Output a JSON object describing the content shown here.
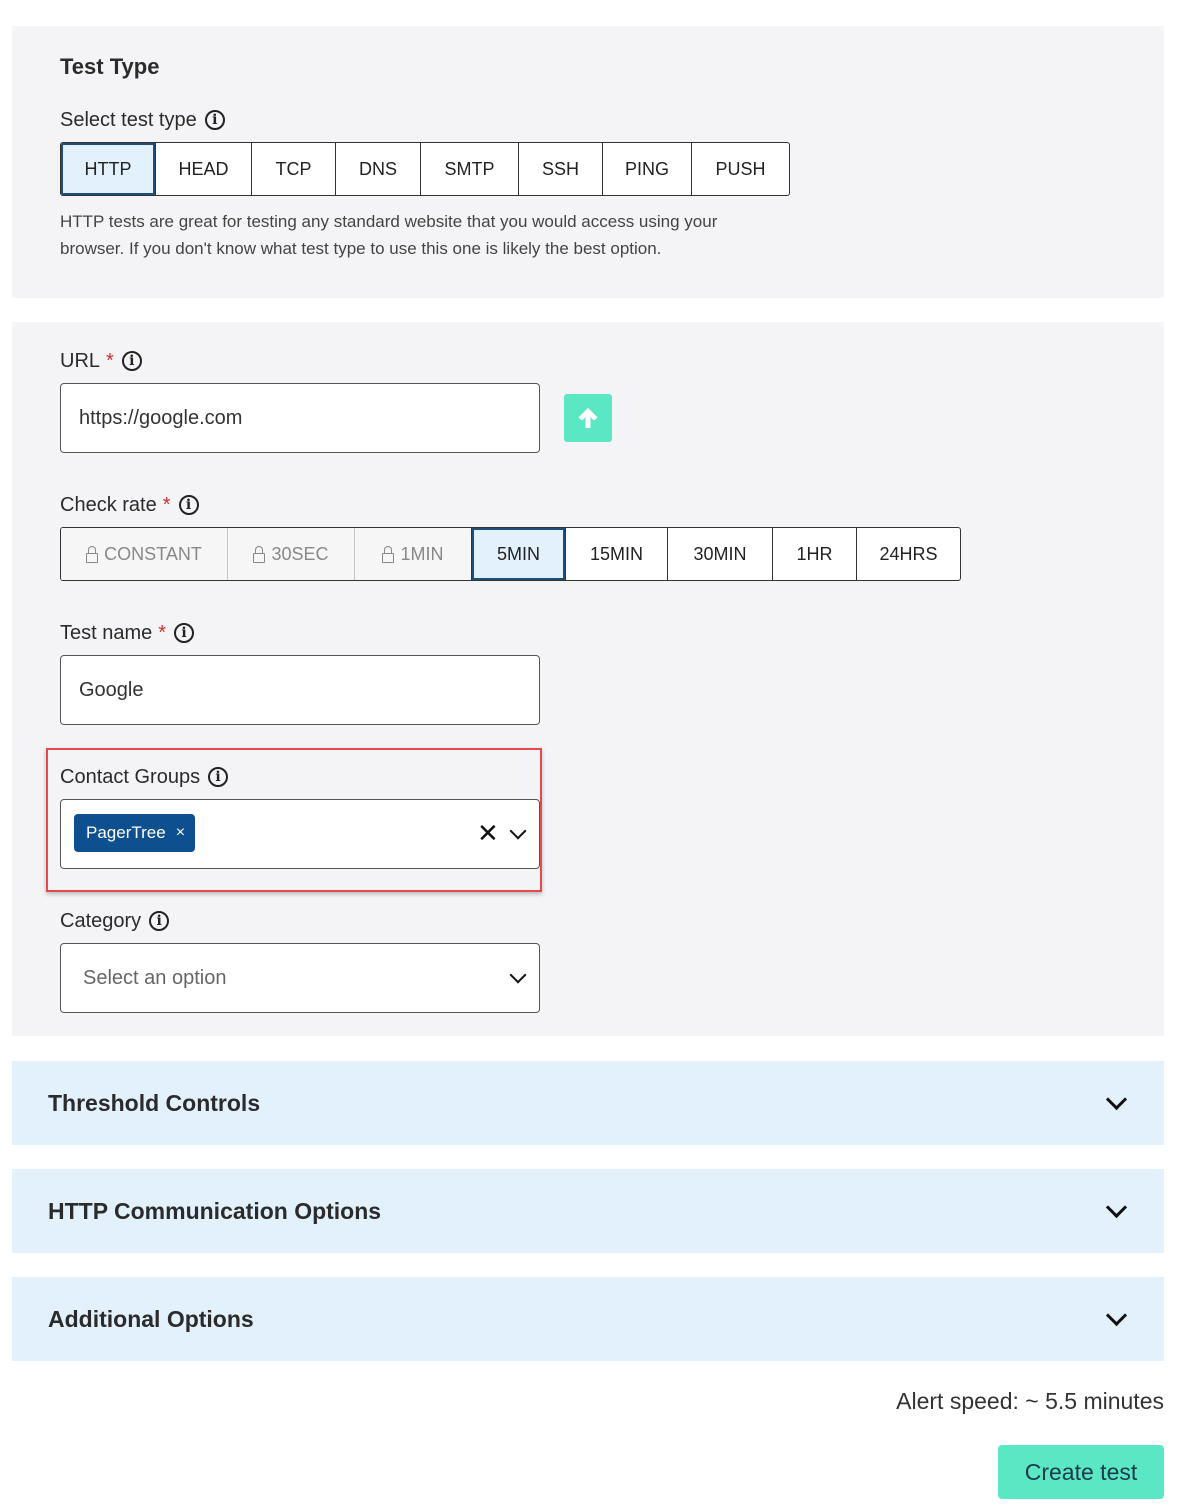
{
  "test_type_section": {
    "title": "Test Type",
    "select_label": "Select test type",
    "options": [
      "HTTP",
      "HEAD",
      "TCP",
      "DNS",
      "SMTP",
      "SSH",
      "PING",
      "PUSH"
    ],
    "selected": "HTTP",
    "description_line1": "HTTP tests are great for testing any standard website that you would access using your",
    "description_line2": "browser. If you don't know what test type to use this one is likely the best option."
  },
  "url": {
    "label": "URL",
    "required_mark": "*",
    "value": "https://google.com",
    "upload_icon": "arrow-up-icon"
  },
  "check_rate": {
    "label": "Check rate",
    "required_mark": "*",
    "options": [
      {
        "label": "CONSTANT",
        "locked": true
      },
      {
        "label": "30SEC",
        "locked": true
      },
      {
        "label": "1MIN",
        "locked": true
      },
      {
        "label": "5MIN",
        "locked": false
      },
      {
        "label": "15MIN",
        "locked": false
      },
      {
        "label": "30MIN",
        "locked": false
      },
      {
        "label": "1HR",
        "locked": false
      },
      {
        "label": "24HRS",
        "locked": false
      }
    ],
    "selected": "5MIN"
  },
  "test_name": {
    "label": "Test name",
    "required_mark": "*",
    "value": "Google"
  },
  "contact_groups": {
    "label": "Contact Groups",
    "chips": [
      "PagerTree"
    ],
    "chip_remove_glyph": "×",
    "clear_glyph": "✕"
  },
  "category": {
    "label": "Category",
    "placeholder": "Select an option"
  },
  "accordions": [
    {
      "title": "Threshold Controls"
    },
    {
      "title": "HTTP Communication Options"
    },
    {
      "title": "Additional Options"
    }
  ],
  "footer": {
    "alert_speed": "Alert speed: ~ 5.5 minutes",
    "create_label": "Create test"
  },
  "colors": {
    "accent": "#5ae8c4",
    "chip": "#0d4f8f",
    "selected_segment": "#e3f1fd",
    "highlight": "#e34b4b"
  }
}
